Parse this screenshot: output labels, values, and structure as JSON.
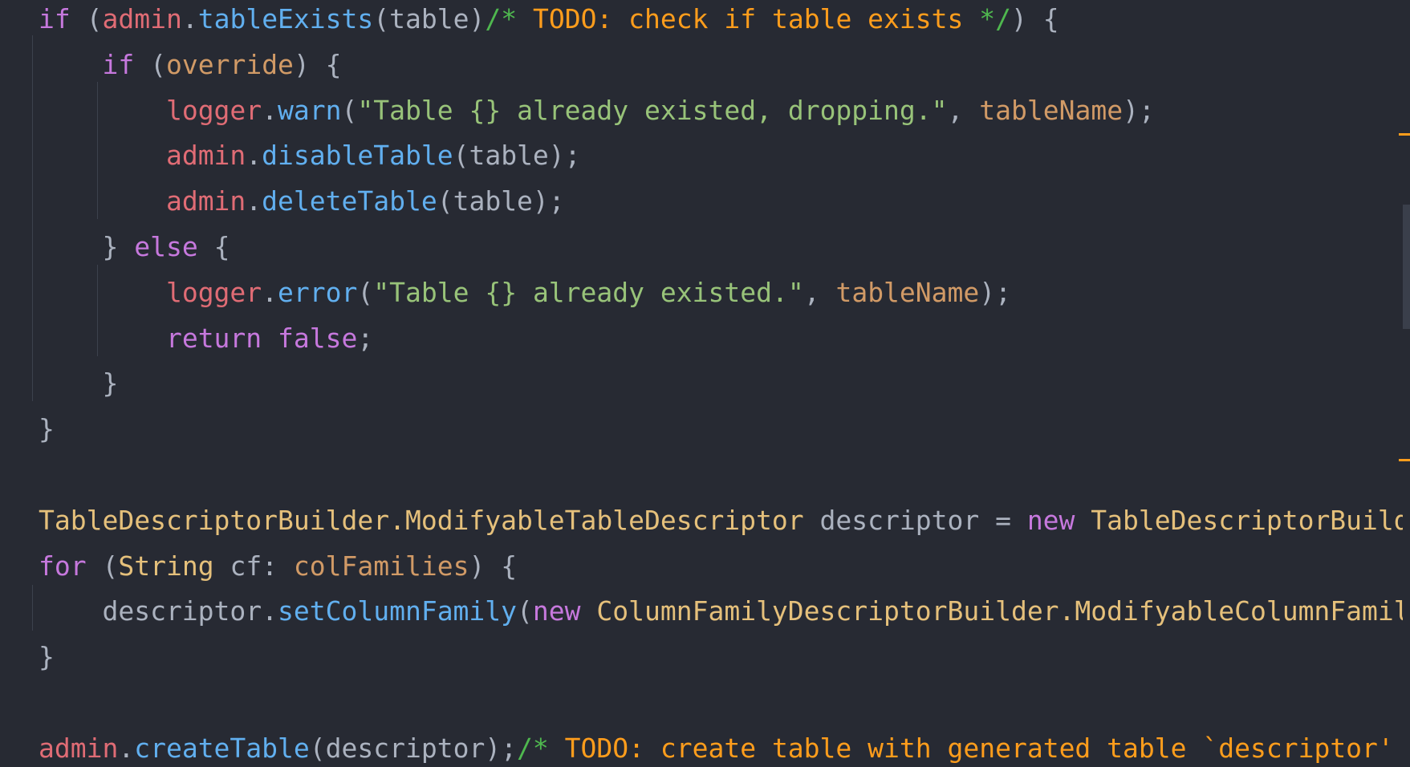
{
  "editor": {
    "language": "java",
    "colors": {
      "background": "#272a33",
      "keyword": "#c678dd",
      "variable": "#e06c75",
      "function": "#61afef",
      "plain": "#abb2bf",
      "string": "#98c379",
      "parameter": "#d19a66",
      "type": "#e5c07b",
      "comment": "#4fb84f",
      "todo": "#ff9d1c"
    },
    "lines": [
      {
        "tokens": [
          {
            "t": "if",
            "c": "kw"
          },
          {
            "t": " (",
            "c": "plain"
          },
          {
            "t": "admin",
            "c": "var"
          },
          {
            "t": ".",
            "c": "plain"
          },
          {
            "t": "tableExists",
            "c": "fn"
          },
          {
            "t": "(table)",
            "c": "plain"
          },
          {
            "t": "/*",
            "c": "cmt"
          },
          {
            "t": " TODO: check if table exists ",
            "c": "todo"
          },
          {
            "t": "*/",
            "c": "cmt"
          },
          {
            "t": ") {",
            "c": "plain"
          }
        ]
      },
      {
        "tokens": [
          {
            "t": "    ",
            "c": "plain"
          },
          {
            "t": "if",
            "c": "kw"
          },
          {
            "t": " (",
            "c": "plain"
          },
          {
            "t": "override",
            "c": "param"
          },
          {
            "t": ") {",
            "c": "plain"
          }
        ]
      },
      {
        "tokens": [
          {
            "t": "        ",
            "c": "plain"
          },
          {
            "t": "logger",
            "c": "var"
          },
          {
            "t": ".",
            "c": "plain"
          },
          {
            "t": "warn",
            "c": "fn"
          },
          {
            "t": "(",
            "c": "plain"
          },
          {
            "t": "\"Table {} already existed, dropping.\"",
            "c": "str"
          },
          {
            "t": ", ",
            "c": "plain"
          },
          {
            "t": "tableName",
            "c": "param"
          },
          {
            "t": ");",
            "c": "plain"
          }
        ]
      },
      {
        "tokens": [
          {
            "t": "        ",
            "c": "plain"
          },
          {
            "t": "admin",
            "c": "var"
          },
          {
            "t": ".",
            "c": "plain"
          },
          {
            "t": "disableTable",
            "c": "fn"
          },
          {
            "t": "(table);",
            "c": "plain"
          }
        ]
      },
      {
        "tokens": [
          {
            "t": "        ",
            "c": "plain"
          },
          {
            "t": "admin",
            "c": "var"
          },
          {
            "t": ".",
            "c": "plain"
          },
          {
            "t": "deleteTable",
            "c": "fn"
          },
          {
            "t": "(table);",
            "c": "plain"
          }
        ]
      },
      {
        "tokens": [
          {
            "t": "    } ",
            "c": "plain"
          },
          {
            "t": "else",
            "c": "kw"
          },
          {
            "t": " {",
            "c": "plain"
          }
        ]
      },
      {
        "tokens": [
          {
            "t": "        ",
            "c": "plain"
          },
          {
            "t": "logger",
            "c": "var"
          },
          {
            "t": ".",
            "c": "plain"
          },
          {
            "t": "error",
            "c": "fn"
          },
          {
            "t": "(",
            "c": "plain"
          },
          {
            "t": "\"Table {} already existed.\"",
            "c": "str"
          },
          {
            "t": ", ",
            "c": "plain"
          },
          {
            "t": "tableName",
            "c": "param"
          },
          {
            "t": ");",
            "c": "plain"
          }
        ]
      },
      {
        "tokens": [
          {
            "t": "        ",
            "c": "plain"
          },
          {
            "t": "return",
            "c": "kw"
          },
          {
            "t": " ",
            "c": "plain"
          },
          {
            "t": "false",
            "c": "kw"
          },
          {
            "t": ";",
            "c": "plain"
          }
        ]
      },
      {
        "tokens": [
          {
            "t": "    }",
            "c": "plain"
          }
        ]
      },
      {
        "tokens": [
          {
            "t": "}",
            "c": "plain"
          }
        ]
      },
      {
        "tokens": []
      },
      {
        "tokens": [
          {
            "t": "TableDescriptorBuilder.ModifyableTableDescriptor",
            "c": "type"
          },
          {
            "t": " descriptor = ",
            "c": "plain"
          },
          {
            "t": "new",
            "c": "kw"
          },
          {
            "t": " ",
            "c": "plain"
          },
          {
            "t": "TableDescriptorBuild",
            "c": "type"
          }
        ]
      },
      {
        "tokens": [
          {
            "t": "for",
            "c": "kw"
          },
          {
            "t": " (",
            "c": "plain"
          },
          {
            "t": "String",
            "c": "type"
          },
          {
            "t": " cf: ",
            "c": "plain"
          },
          {
            "t": "colFamilies",
            "c": "param"
          },
          {
            "t": ") {",
            "c": "plain"
          }
        ]
      },
      {
        "tokens": [
          {
            "t": "    descriptor.",
            "c": "plain"
          },
          {
            "t": "setColumnFamily",
            "c": "fn"
          },
          {
            "t": "(",
            "c": "plain"
          },
          {
            "t": "new",
            "c": "kw"
          },
          {
            "t": " ",
            "c": "plain"
          },
          {
            "t": "ColumnFamilyDescriptorBuilder.ModifyableColumnFamil",
            "c": "type"
          }
        ]
      },
      {
        "tokens": [
          {
            "t": "}",
            "c": "plain"
          }
        ]
      },
      {
        "tokens": []
      },
      {
        "tokens": [
          {
            "t": "admin",
            "c": "var"
          },
          {
            "t": ".",
            "c": "plain"
          },
          {
            "t": "createTable",
            "c": "fn"
          },
          {
            "t": "(descriptor);",
            "c": "plain"
          },
          {
            "t": "/*",
            "c": "cmt"
          },
          {
            "t": " TODO: create table with generated table `descriptor'",
            "c": "todo"
          }
        ]
      }
    ]
  }
}
